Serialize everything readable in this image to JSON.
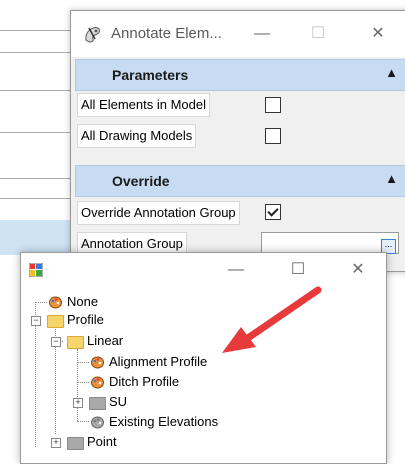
{
  "annotate_dialog": {
    "title": "Annotate Elem...",
    "window_buttons": {
      "minimize": "—",
      "maximize": "☐",
      "close": "✕"
    },
    "parameters": {
      "header": "Parameters",
      "rows": [
        {
          "label": "All Elements in Model",
          "checked": false
        },
        {
          "label": "All Drawing Models",
          "checked": false
        }
      ]
    },
    "override": {
      "header": "Override",
      "rows": [
        {
          "label": "Override Annotation Group",
          "checked": true
        },
        {
          "label": "Annotation Group",
          "value": ""
        }
      ]
    },
    "browse_label": "..."
  },
  "tree_dialog": {
    "window_buttons": {
      "minimize": "—",
      "maximize": "☐",
      "close": "✕"
    },
    "nodes": [
      {
        "label": "None",
        "icon": "palette-icon"
      },
      {
        "label": "Profile",
        "icon": "folder-icon",
        "expanded": true
      },
      {
        "label": "Linear",
        "icon": "folder-icon",
        "expanded": true
      },
      {
        "label": "Alignment Profile",
        "icon": "palette-icon"
      },
      {
        "label": "Ditch Profile",
        "icon": "palette-icon"
      },
      {
        "label": "SU",
        "icon": "folder-gray-icon",
        "expanded": false
      },
      {
        "label": "Existing Elevations",
        "icon": "palette-gray-icon"
      },
      {
        "label": "Point",
        "icon": "folder-gray-icon",
        "expanded": false
      }
    ]
  },
  "colors": {
    "section_header": "#c7dcf3",
    "arrow": "#e8393b",
    "folder": "#f7d56b"
  }
}
